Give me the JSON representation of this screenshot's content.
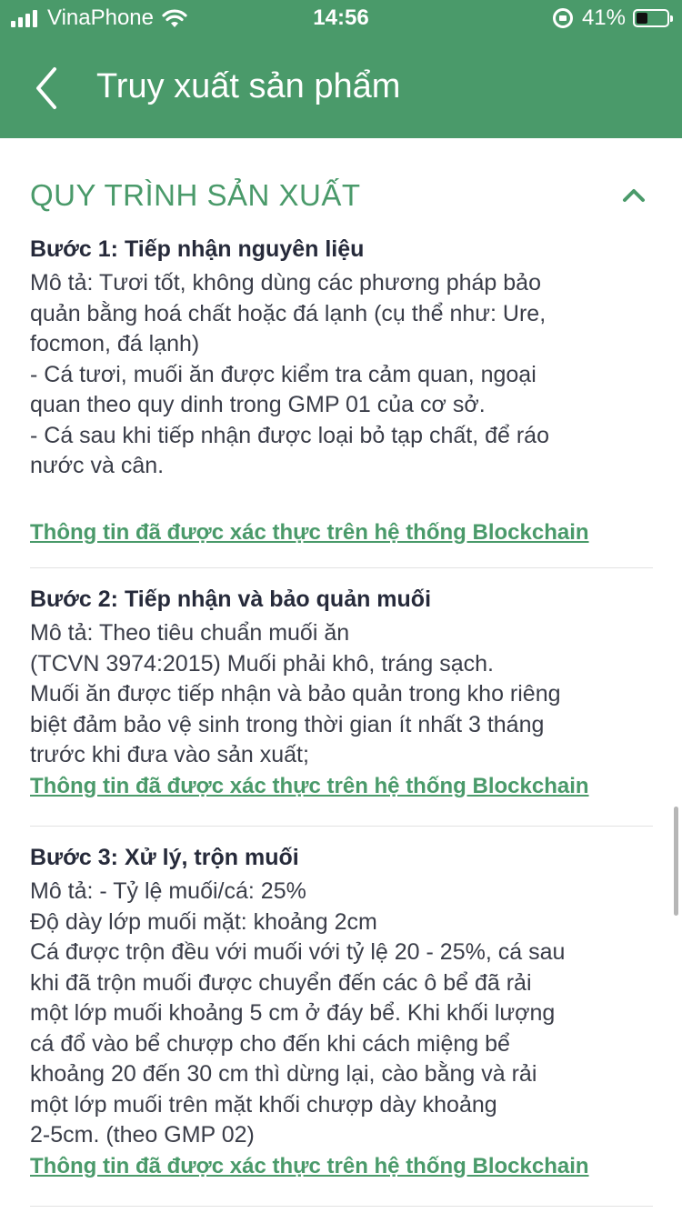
{
  "status_bar": {
    "carrier": "VinaPhone",
    "time": "14:56",
    "battery": "41%",
    "battery_level": 0.41
  },
  "header": {
    "title": "Truy xuất sản phẩm"
  },
  "section": {
    "title": "QUY TRÌNH SẢN XUẤT"
  },
  "steps": [
    {
      "title": "Bước 1: Tiếp nhận nguyên liệu",
      "description": "Mô tả: Tươi tốt, không dùng các phương pháp bảo\nquản bằng hoá chất hoặc đá lạnh (cụ thể như: Ure,\nfocmon, đá lạnh)\n-  Cá tươi, muối ăn được kiểm tra cảm quan, ngoại\nquan theo quy dinh trong GMP 01 của cơ sở.\n- Cá sau khi tiếp nhận được loại bỏ tạp chất, để ráo\nnước và cân.",
      "link": "Thông tin đã được xác thực trên hệ thống Blockchain"
    },
    {
      "title": "Bước 2: Tiếp nhận và bảo quản muối",
      "description": "Mô tả: Theo tiêu chuẩn muối ăn\n(TCVN 3974:2015) Muối phải khô, tráng sạch.\nMuối ăn được tiếp nhận và bảo quản trong kho riêng\nbiệt đảm bảo vệ sinh trong thời gian ít nhất 3 tháng\ntrước khi đưa vào sản xuất;",
      "link": "Thông tin đã được xác thực trên hệ thống Blockchain"
    },
    {
      "title": "Bước 3: Xử lý, trộn muối",
      "description": "Mô tả: -  Tỷ lệ muối/cá: 25%\nĐộ dày lớp muối mặt: khoảng 2cm\nCá được trộn đều với muối với tỷ lệ 20 - 25%, cá sau\nkhi đã trộn muối được chuyển đến các ô bể đã rải\nmột lớp muối khoảng 5 cm ở đáy bể. Khi khối lượng\ncá đổ vào bể chượp cho đến khi cách miệng bể\nkhoảng 20 đến 30 cm thì dừng lại, cào bằng và rải\nmột lớp muối trên mặt khối chượp dày khoảng\n2-5cm. (theo GMP 02)",
      "link": "Thông tin đã được xác thực trên hệ thống Blockchain"
    }
  ],
  "icons": {
    "back": "chevron-left-icon",
    "collapse": "chevron-up-icon"
  },
  "colors": {
    "brand_green": "#4a9a6a",
    "text_dark": "#262a3a"
  }
}
